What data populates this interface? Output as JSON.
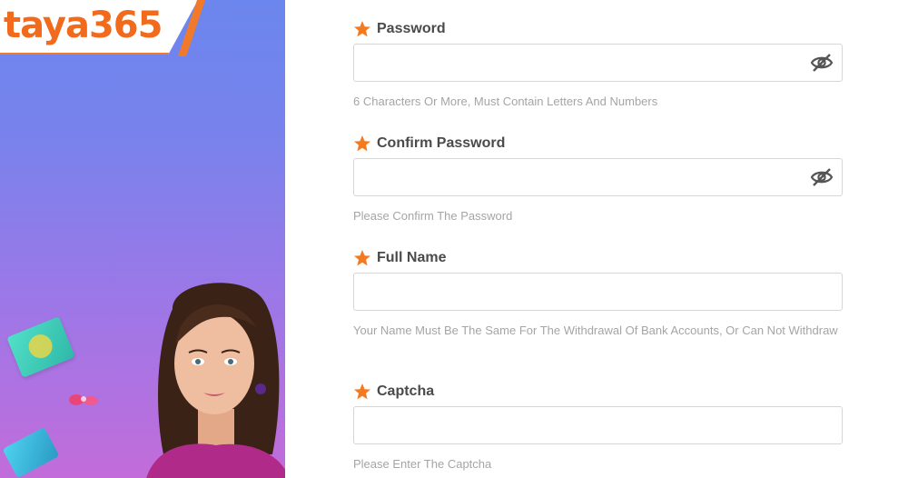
{
  "brand": {
    "logo_text": "taya365",
    "accent_color": "#f26a1b"
  },
  "form": {
    "password": {
      "label": "Password",
      "placeholder": "",
      "hint": "6 Characters Or More, Must Contain Letters And Numbers",
      "icon": "eye-slash-icon"
    },
    "confirm_password": {
      "label": "Confirm Password",
      "placeholder": "",
      "hint": "Please Confirm The Password",
      "icon": "eye-slash-icon"
    },
    "full_name": {
      "label": "Full Name",
      "placeholder": "",
      "hint": "Your Name Must Be The Same For The Withdrawal Of Bank Accounts, Or Can Not Withdraw"
    },
    "captcha": {
      "label": "Captcha",
      "placeholder": "",
      "hint": "Please Enter The Captcha"
    }
  },
  "colors": {
    "required_star": "#f47a20",
    "label": "#4a4a4a",
    "hint": "#a5a5a5",
    "panel_top": "#6b86ee",
    "panel_bottom": "#c26cd9"
  }
}
